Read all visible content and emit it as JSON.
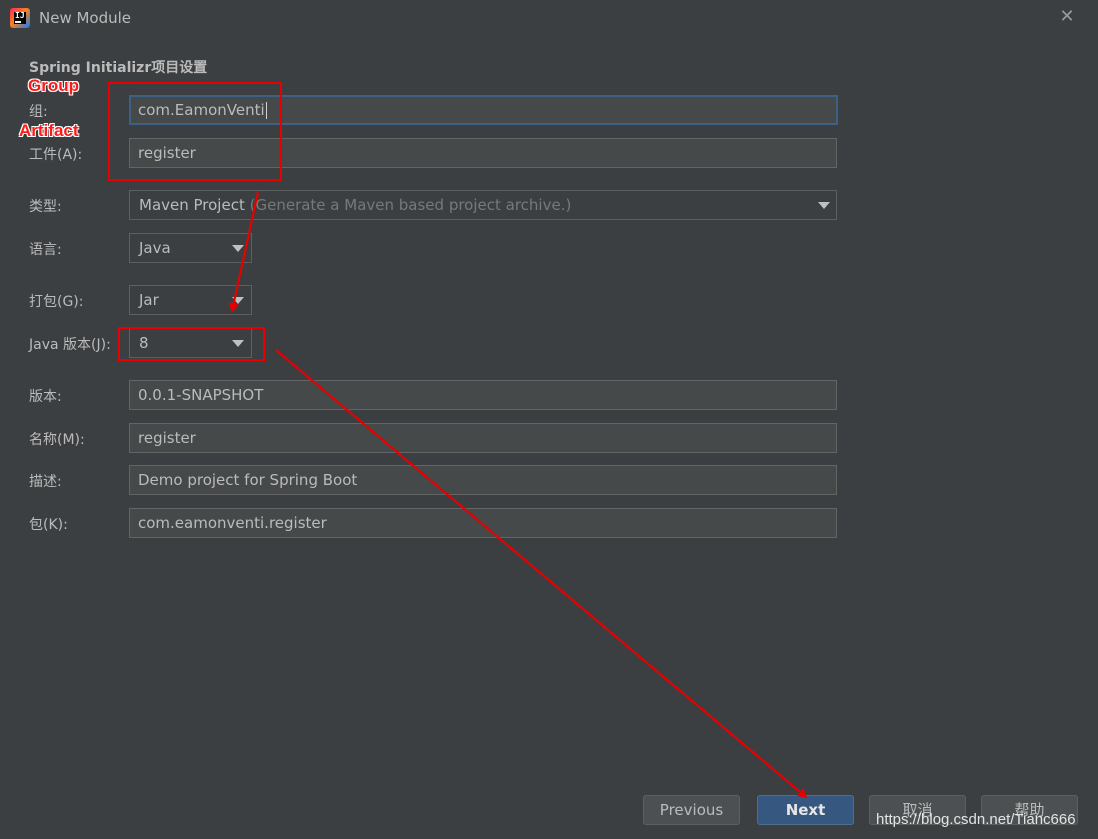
{
  "window": {
    "title": "New Module",
    "close_icon": "close-icon",
    "app_icon_glyph": "IJ"
  },
  "section_title": "Spring Initializr项目设置",
  "fields": {
    "group": {
      "label": "组:",
      "value": "com.EamonVenti"
    },
    "artifact": {
      "label": "工件(A):",
      "value": "register"
    },
    "type": {
      "label": "类型:",
      "value": "Maven Project",
      "hint": "(Generate a Maven based project archive.)"
    },
    "language": {
      "label": "语言:",
      "value": "Java"
    },
    "packaging": {
      "label": "打包(G):",
      "value": "Jar"
    },
    "java_version": {
      "label": "Java 版本(J):",
      "value": "8"
    },
    "version": {
      "label": "版本:",
      "value": "0.0.1-SNAPSHOT"
    },
    "name": {
      "label": "名称(M):",
      "value": "register"
    },
    "description": {
      "label": "描述:",
      "value": "Demo project for Spring Boot"
    },
    "package": {
      "label": "包(K):",
      "value": "com.eamonventi.register"
    }
  },
  "buttons": {
    "previous": "Previous",
    "next": "Next",
    "cancel": "取消",
    "help": "帮助"
  },
  "annotations": {
    "group": "Group",
    "artifact": "Artifact",
    "color": "#e60000"
  },
  "watermark": "https://blog.csdn.net/Tianc666",
  "colors": {
    "background": "#3c3f41",
    "field_bg": "#45494a",
    "focus_border": "#3d6185",
    "primary_button": "#365880"
  }
}
